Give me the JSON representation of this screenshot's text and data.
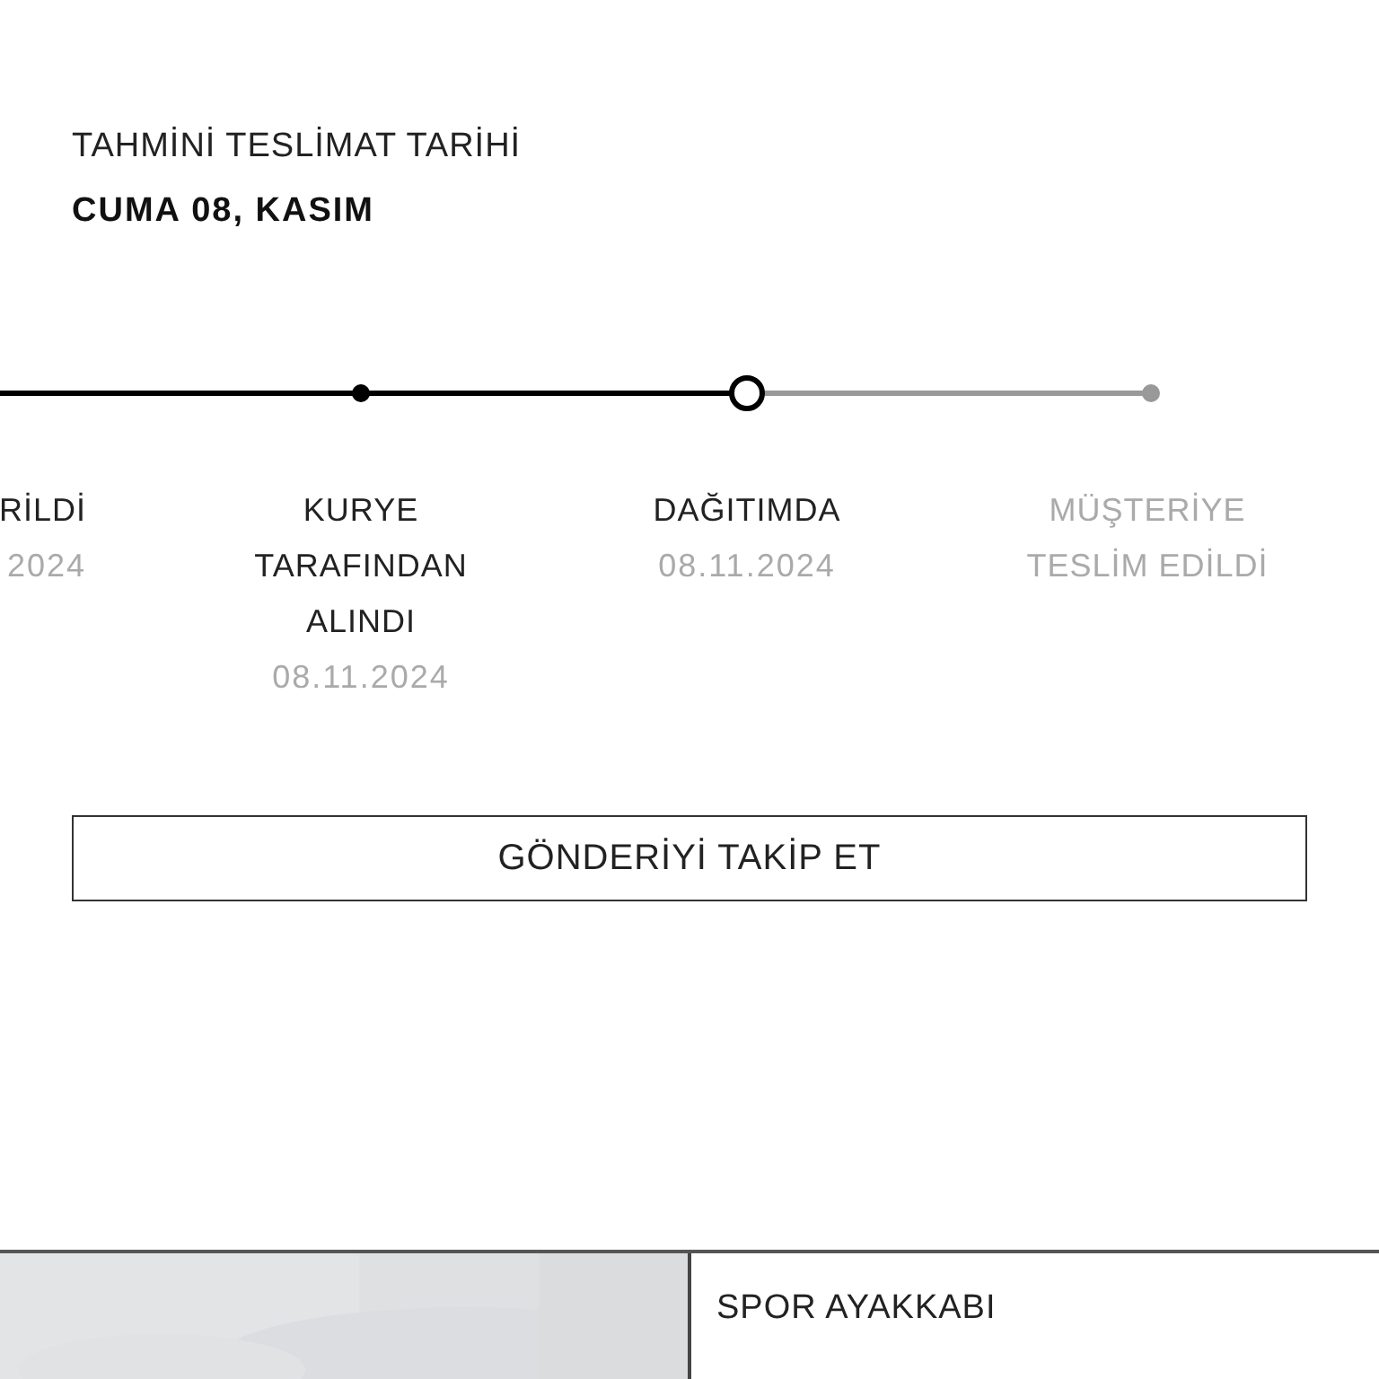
{
  "delivery_estimate": {
    "label": "TAHMİNİ TESLİMAT TARİHİ",
    "date": "CUMA 08, KASIM"
  },
  "steps": [
    {
      "label": "RİLDİ",
      "date": "2024",
      "kind": "done"
    },
    {
      "label": "KURYE TARAFINDAN ALINDI",
      "date": "08.11.2024",
      "kind": "done"
    },
    {
      "label": "DAĞITIMDA",
      "date": "08.11.2024",
      "kind": "current"
    },
    {
      "label": "MÜŞTERİYE TESLİM EDİLDİ",
      "kind": "pending"
    }
  ],
  "track_button": "GÖNDERİYİ TAKİP ET",
  "product": {
    "name": "SPOR AYAKKABI"
  }
}
